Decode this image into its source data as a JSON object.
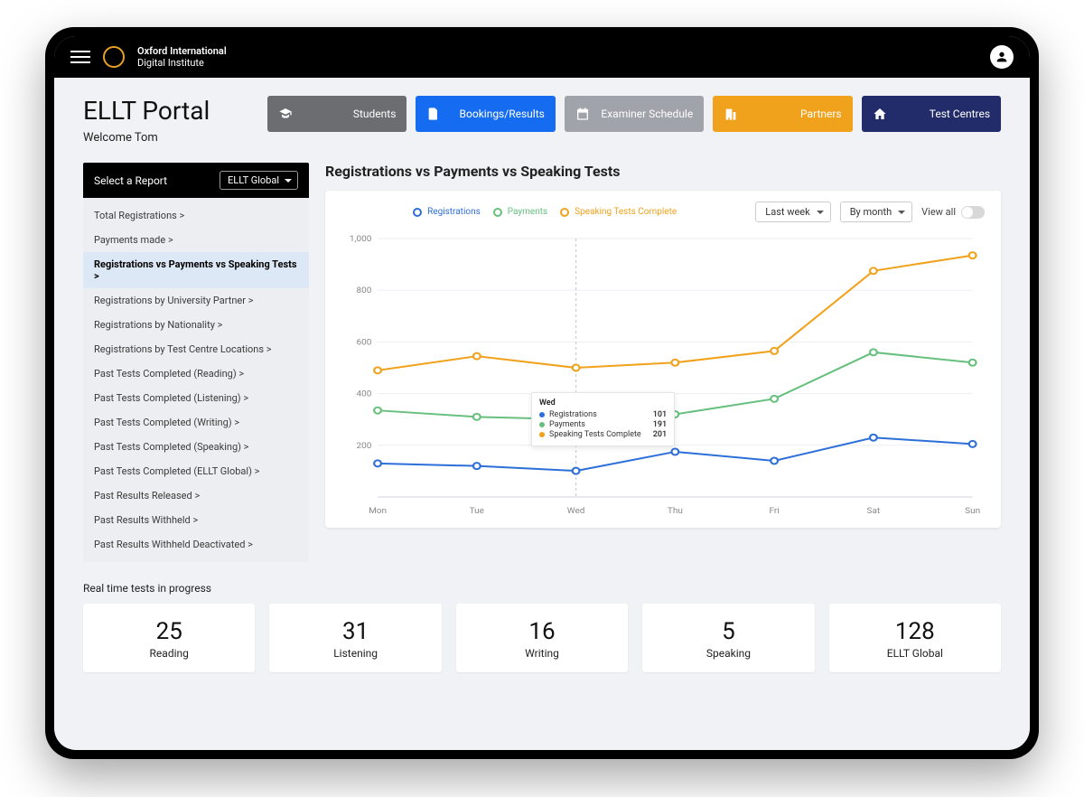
{
  "brand": {
    "line1": "Oxford International",
    "line2": "Digital Institute"
  },
  "header": {
    "title": "ELLT Portal",
    "welcome": "Welcome Tom"
  },
  "nav": {
    "students": {
      "label": "Students",
      "color": "#6b6d71"
    },
    "bookings": {
      "label": "Bookings/Results",
      "color": "#166cf0"
    },
    "examiner": {
      "label": "Examiner Schedule",
      "color": "#a0a3a9"
    },
    "partners": {
      "label": "Partners",
      "color": "#f1a21c"
    },
    "centres": {
      "label": "Test Centres",
      "color": "#222c6b"
    }
  },
  "sidebar": {
    "head_label": "Select a Report",
    "head_select": "ELLT Global",
    "items": [
      {
        "label": "Total Registrations >"
      },
      {
        "label": "Payments made >"
      },
      {
        "label": "Registrations vs Payments vs Speaking Tests >",
        "active": true
      },
      {
        "label": "Registrations by University Partner >"
      },
      {
        "label": "Registrations by Nationality >"
      },
      {
        "label": "Registrations by Test Centre Locations >"
      },
      {
        "label": "Past Tests Completed (Reading) >"
      },
      {
        "label": "Past Tests Completed (Listening) >"
      },
      {
        "label": "Past Tests Completed (Writing) >"
      },
      {
        "label": "Past Tests Completed (Speaking) >"
      },
      {
        "label": "Past Tests Completed (ELLT Global) >"
      },
      {
        "label": "Past Results Released >"
      },
      {
        "label": "Past Results Withheld >"
      },
      {
        "label": "Past Results Withheld Deactivated >"
      }
    ]
  },
  "chart": {
    "title": "Registrations vs Payments vs Speaking Tests",
    "legend": {
      "reg": "Registrations",
      "pay": "Payments",
      "sp": "Speaking Tests Complete"
    },
    "controls": {
      "period": "Last week",
      "group": "By month",
      "viewall": "View all"
    },
    "tooltip": {
      "day": "Wed",
      "rows": [
        {
          "label": "Registrations",
          "val": "101",
          "color": "#2d6fd9"
        },
        {
          "label": "Payments",
          "val": "191",
          "color": "#67c07e"
        },
        {
          "label": "Speaking Tests Complete",
          "val": "201",
          "color": "#f1a21c"
        }
      ]
    }
  },
  "chart_data": {
    "type": "line",
    "categories": [
      "Mon",
      "Tue",
      "Wed",
      "Thu",
      "Fri",
      "Sat",
      "Sun"
    ],
    "series": [
      {
        "name": "Registrations",
        "color": "#2d6fd9",
        "values": [
          130,
          120,
          101,
          175,
          140,
          230,
          205
        ]
      },
      {
        "name": "Payments",
        "color": "#67c07e",
        "values": [
          335,
          310,
          300,
          320,
          380,
          560,
          520
        ]
      },
      {
        "name": "Speaking Tests Complete",
        "color": "#f1a21c",
        "values": [
          490,
          545,
          500,
          520,
          565,
          875,
          935
        ]
      }
    ],
    "ylabel": "",
    "xlabel": "",
    "yticks": [
      200,
      400,
      600,
      800,
      1000
    ],
    "ylim": [
      0,
      1000
    ]
  },
  "stats": {
    "title": "Real time tests in progress",
    "cards": [
      {
        "value": "25",
        "label": "Reading"
      },
      {
        "value": "31",
        "label": "Listening"
      },
      {
        "value": "16",
        "label": "Writing"
      },
      {
        "value": "5",
        "label": "Speaking"
      },
      {
        "value": "128",
        "label": "ELLT Global"
      }
    ]
  },
  "colors": {
    "blue": "#2d6fd9",
    "green": "#67c07e",
    "orange": "#f1a21c"
  }
}
